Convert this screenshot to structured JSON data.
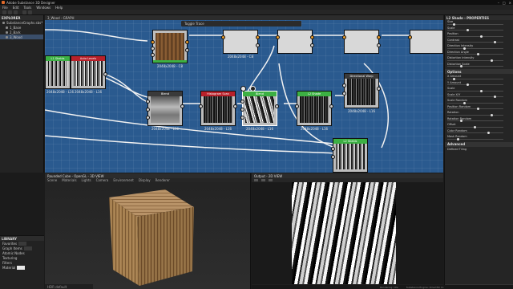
{
  "titlebar": {
    "title": "Adobe Substance 3D Designer"
  },
  "menubar": {
    "items": [
      "File",
      "Edit",
      "Tools",
      "Windows",
      "Help"
    ]
  },
  "explorer": {
    "title": "EXPLORER",
    "items": [
      {
        "label": "SubstanceGraphs.sbs*"
      },
      {
        "label": "1_Base"
      },
      {
        "label": "2_Bark"
      },
      {
        "label": "3_Wood"
      }
    ]
  },
  "graph": {
    "tab": "3_Wood - GRAPH",
    "toolbar_text": "Toggle Trace",
    "nodes": [
      {
        "caption": "2048x2048 - C8",
        "head": ""
      },
      {
        "caption": "2048x2048 - C8",
        "head": ""
      },
      {
        "caption": "2048x2048 - L16",
        "head": "L1 Shelds"
      },
      {
        "caption": "2048x2048 - L16",
        "head": "Auto Levels"
      },
      {
        "caption": "2048x2048 - L16",
        "head": "Blend"
      },
      {
        "caption": "2048x2048 - L16",
        "head": "Histogram Scan"
      },
      {
        "caption": "2048x2048 - L16",
        "head": "Blend"
      },
      {
        "caption": "2048x2048 - L16",
        "head": "L2 Shade"
      },
      {
        "caption": "2048x2048 - L16",
        "head": "Directional Warp"
      },
      {
        "caption": "2048x2048 - L16",
        "head": "L2 Shelds"
      }
    ]
  },
  "properties": {
    "title": "L2 Shade - PROPERTIES",
    "rows": [
      {
        "label": "Size",
        "value": ""
      },
      {
        "label": "Scale",
        "value": ""
      },
      {
        "label": "Position",
        "value": ""
      },
      {
        "label": "Contrast",
        "value": ""
      },
      {
        "label": "Direction Intensity",
        "value": ""
      },
      {
        "label": "Direction Angle",
        "value": ""
      },
      {
        "label": "Distortion Intensity",
        "value": ""
      },
      {
        "label": "Distortion Scale",
        "value": ""
      }
    ],
    "section1": "Options",
    "rows2": [
      {
        "label": "X Amount",
        "value": ""
      },
      {
        "label": "Y Amount",
        "value": ""
      },
      {
        "label": "Scale",
        "value": ""
      },
      {
        "label": "Scale X/Y",
        "value": ""
      },
      {
        "label": "Scale Random",
        "value": ""
      },
      {
        "label": "Position Random",
        "value": ""
      },
      {
        "label": "Rotation",
        "value": ""
      },
      {
        "label": "Rotation Random",
        "value": ""
      },
      {
        "label": "Offset",
        "value": ""
      },
      {
        "label": "Color Random",
        "value": ""
      },
      {
        "label": "Mask Random",
        "value": ""
      }
    ],
    "section2": "Advanced",
    "row_final": "Defined Tiling",
    "footer": "INPUT VALUES"
  },
  "view3d": {
    "title": "Rounded Cube - OpenGL - 3D VIEW",
    "menu": [
      "Scene",
      "Materials",
      "Lights",
      "Camera",
      "Environment",
      "Display",
      "Renderer"
    ],
    "footer": "HDR default"
  },
  "view2d": {
    "title": "Output - 2D VIEW",
    "footer": "2048 x 2048 (Grayscale, 16bpc)"
  },
  "library": {
    "title": "LIBRARY",
    "items": [
      "Favorites",
      "Graph Items",
      "Atomic Nodes",
      "Texturing",
      "Filters",
      "Material"
    ]
  },
  "statusbar": {
    "left": "Rendering: Idle",
    "right": "Substance Engine: Direct3D 11"
  }
}
